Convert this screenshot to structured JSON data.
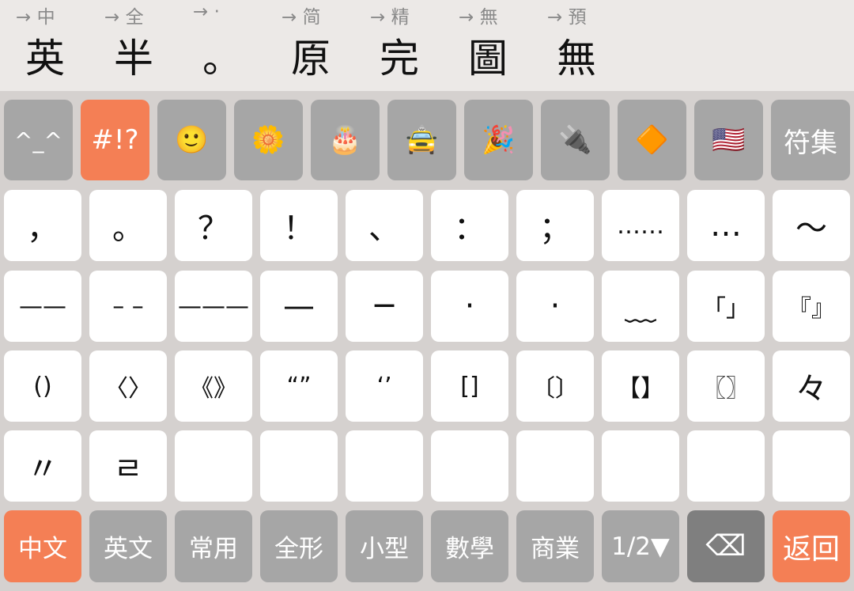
{
  "modes": [
    {
      "hint": "→ 中",
      "label": "英"
    },
    {
      "hint": "→ 全",
      "label": "半"
    },
    {
      "hint": "→ ·",
      "label": "。"
    },
    {
      "hint": "→ 简",
      "label": "原"
    },
    {
      "hint": "→ 精",
      "label": "完"
    },
    {
      "hint": "→ 無",
      "label": "圖"
    },
    {
      "hint": "→ 預",
      "label": "無"
    }
  ],
  "categories": [
    {
      "label": "^_^",
      "name": "kaomoji"
    },
    {
      "label": "#!?",
      "name": "symbols",
      "active": true
    },
    {
      "label": "🙂",
      "name": "smiley-emoji"
    },
    {
      "label": "🌼",
      "name": "nature-emoji"
    },
    {
      "label": "🎂",
      "name": "food-emoji"
    },
    {
      "label": "🚖",
      "name": "travel-emoji"
    },
    {
      "label": "🎉",
      "name": "activity-emoji"
    },
    {
      "label": "🔌",
      "name": "objects-emoji"
    },
    {
      "label": "🔶",
      "name": "symbols-emoji"
    },
    {
      "label": "🇺🇸",
      "name": "flags-emoji"
    },
    {
      "label": "符集",
      "name": "charset"
    }
  ],
  "symbol_rows": [
    [
      "，",
      "。",
      "？",
      "！",
      "、",
      "：",
      "；",
      "……",
      "…",
      "～"
    ],
    [
      "——",
      "– –",
      "———",
      "—",
      "─",
      "·",
      "·",
      "﹏",
      "「」",
      "『』"
    ],
    [
      "()",
      "〈〉",
      "《》",
      "“”",
      "‘’",
      "[]",
      "〔〕",
      "【】",
      "〖〗",
      "々"
    ],
    [
      "〃",
      "ㄹ",
      "",
      "",
      "",
      "",
      "",
      "",
      "",
      ""
    ]
  ],
  "bottom": [
    {
      "label": "中文",
      "name": "chinese"
    },
    {
      "label": "英文",
      "name": "english"
    },
    {
      "label": "常用",
      "name": "common"
    },
    {
      "label": "全形",
      "name": "fullwidth"
    },
    {
      "label": "小型",
      "name": "small"
    },
    {
      "label": "數學",
      "name": "math"
    },
    {
      "label": "商業",
      "name": "business"
    },
    {
      "label": "1/2▼",
      "name": "page"
    },
    {
      "label": "⌫",
      "name": "backspace",
      "icon": "backspace-icon"
    },
    {
      "label": "返回",
      "name": "return"
    }
  ],
  "colors": {
    "accent": "#f47f55",
    "key_gray": "#a6a6a6",
    "key_dark": "#7f7f7f",
    "key_white": "#ffffff"
  }
}
